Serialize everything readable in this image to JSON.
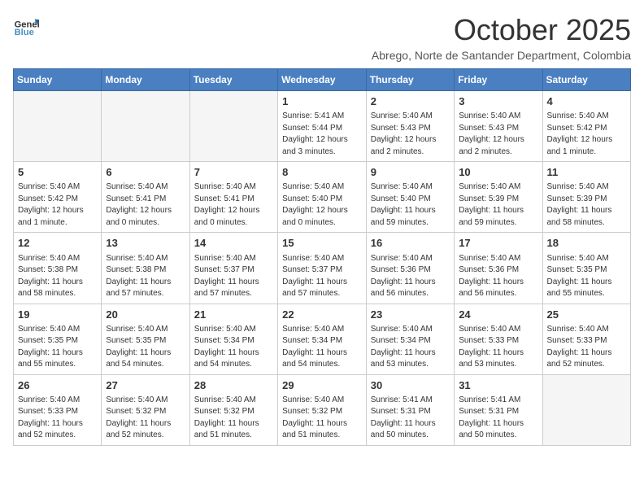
{
  "logo": {
    "general": "General",
    "blue": "Blue"
  },
  "header": {
    "month": "October 2025",
    "subtitle": "Abrego, Norte de Santander Department, Colombia"
  },
  "days_of_week": [
    "Sunday",
    "Monday",
    "Tuesday",
    "Wednesday",
    "Thursday",
    "Friday",
    "Saturday"
  ],
  "weeks": [
    [
      {
        "day": "",
        "info": ""
      },
      {
        "day": "",
        "info": ""
      },
      {
        "day": "",
        "info": ""
      },
      {
        "day": "1",
        "info": "Sunrise: 5:41 AM\nSunset: 5:44 PM\nDaylight: 12 hours\nand 3 minutes."
      },
      {
        "day": "2",
        "info": "Sunrise: 5:40 AM\nSunset: 5:43 PM\nDaylight: 12 hours\nand 2 minutes."
      },
      {
        "day": "3",
        "info": "Sunrise: 5:40 AM\nSunset: 5:43 PM\nDaylight: 12 hours\nand 2 minutes."
      },
      {
        "day": "4",
        "info": "Sunrise: 5:40 AM\nSunset: 5:42 PM\nDaylight: 12 hours\nand 1 minute."
      }
    ],
    [
      {
        "day": "5",
        "info": "Sunrise: 5:40 AM\nSunset: 5:42 PM\nDaylight: 12 hours\nand 1 minute."
      },
      {
        "day": "6",
        "info": "Sunrise: 5:40 AM\nSunset: 5:41 PM\nDaylight: 12 hours\nand 0 minutes."
      },
      {
        "day": "7",
        "info": "Sunrise: 5:40 AM\nSunset: 5:41 PM\nDaylight: 12 hours\nand 0 minutes."
      },
      {
        "day": "8",
        "info": "Sunrise: 5:40 AM\nSunset: 5:40 PM\nDaylight: 12 hours\nand 0 minutes."
      },
      {
        "day": "9",
        "info": "Sunrise: 5:40 AM\nSunset: 5:40 PM\nDaylight: 11 hours\nand 59 minutes."
      },
      {
        "day": "10",
        "info": "Sunrise: 5:40 AM\nSunset: 5:39 PM\nDaylight: 11 hours\nand 59 minutes."
      },
      {
        "day": "11",
        "info": "Sunrise: 5:40 AM\nSunset: 5:39 PM\nDaylight: 11 hours\nand 58 minutes."
      }
    ],
    [
      {
        "day": "12",
        "info": "Sunrise: 5:40 AM\nSunset: 5:38 PM\nDaylight: 11 hours\nand 58 minutes."
      },
      {
        "day": "13",
        "info": "Sunrise: 5:40 AM\nSunset: 5:38 PM\nDaylight: 11 hours\nand 57 minutes."
      },
      {
        "day": "14",
        "info": "Sunrise: 5:40 AM\nSunset: 5:37 PM\nDaylight: 11 hours\nand 57 minutes."
      },
      {
        "day": "15",
        "info": "Sunrise: 5:40 AM\nSunset: 5:37 PM\nDaylight: 11 hours\nand 57 minutes."
      },
      {
        "day": "16",
        "info": "Sunrise: 5:40 AM\nSunset: 5:36 PM\nDaylight: 11 hours\nand 56 minutes."
      },
      {
        "day": "17",
        "info": "Sunrise: 5:40 AM\nSunset: 5:36 PM\nDaylight: 11 hours\nand 56 minutes."
      },
      {
        "day": "18",
        "info": "Sunrise: 5:40 AM\nSunset: 5:35 PM\nDaylight: 11 hours\nand 55 minutes."
      }
    ],
    [
      {
        "day": "19",
        "info": "Sunrise: 5:40 AM\nSunset: 5:35 PM\nDaylight: 11 hours\nand 55 minutes."
      },
      {
        "day": "20",
        "info": "Sunrise: 5:40 AM\nSunset: 5:35 PM\nDaylight: 11 hours\nand 54 minutes."
      },
      {
        "day": "21",
        "info": "Sunrise: 5:40 AM\nSunset: 5:34 PM\nDaylight: 11 hours\nand 54 minutes."
      },
      {
        "day": "22",
        "info": "Sunrise: 5:40 AM\nSunset: 5:34 PM\nDaylight: 11 hours\nand 54 minutes."
      },
      {
        "day": "23",
        "info": "Sunrise: 5:40 AM\nSunset: 5:34 PM\nDaylight: 11 hours\nand 53 minutes."
      },
      {
        "day": "24",
        "info": "Sunrise: 5:40 AM\nSunset: 5:33 PM\nDaylight: 11 hours\nand 53 minutes."
      },
      {
        "day": "25",
        "info": "Sunrise: 5:40 AM\nSunset: 5:33 PM\nDaylight: 11 hours\nand 52 minutes."
      }
    ],
    [
      {
        "day": "26",
        "info": "Sunrise: 5:40 AM\nSunset: 5:33 PM\nDaylight: 11 hours\nand 52 minutes."
      },
      {
        "day": "27",
        "info": "Sunrise: 5:40 AM\nSunset: 5:32 PM\nDaylight: 11 hours\nand 52 minutes."
      },
      {
        "day": "28",
        "info": "Sunrise: 5:40 AM\nSunset: 5:32 PM\nDaylight: 11 hours\nand 51 minutes."
      },
      {
        "day": "29",
        "info": "Sunrise: 5:40 AM\nSunset: 5:32 PM\nDaylight: 11 hours\nand 51 minutes."
      },
      {
        "day": "30",
        "info": "Sunrise: 5:41 AM\nSunset: 5:31 PM\nDaylight: 11 hours\nand 50 minutes."
      },
      {
        "day": "31",
        "info": "Sunrise: 5:41 AM\nSunset: 5:31 PM\nDaylight: 11 hours\nand 50 minutes."
      },
      {
        "day": "",
        "info": ""
      }
    ]
  ]
}
